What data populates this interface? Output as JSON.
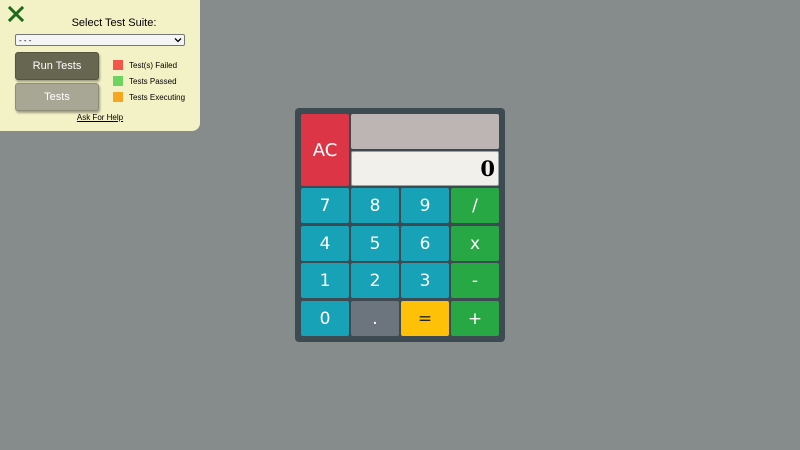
{
  "test_panel": {
    "suite_label": "Select Test Suite:",
    "suite_select_value": "- - -",
    "run_tests_label": "Run Tests",
    "tests_label": "Tests",
    "legend": [
      {
        "label": "Test(s) Failed",
        "color": "#f4574a"
      },
      {
        "label": "Tests Passed",
        "color": "#6bd55f"
      },
      {
        "label": "Tests Executing",
        "color": "#f6a621"
      }
    ],
    "help_link": "Ask For Help",
    "close_icon_color": "#1b6b1b"
  },
  "calculator": {
    "formula": "",
    "display": "0",
    "keys": {
      "clear": "AC",
      "seven": "7",
      "eight": "8",
      "nine": "9",
      "divide": "/",
      "four": "4",
      "five": "5",
      "six": "6",
      "multiply": "x",
      "one": "1",
      "two": "2",
      "three": "3",
      "subtract": "-",
      "zero": "0",
      "decimal": ".",
      "equals": "=",
      "add": "+"
    }
  }
}
